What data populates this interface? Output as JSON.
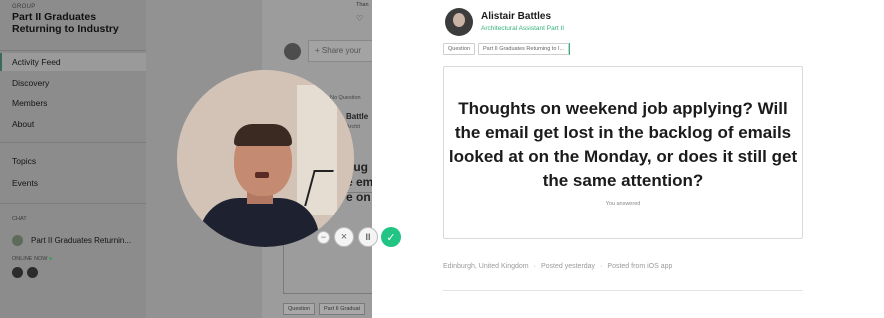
{
  "sidebar": {
    "group_label": "GROUP",
    "group_title": "Part II Graduates Returning to Industry",
    "nav": [
      {
        "label": "Activity Feed"
      },
      {
        "label": "Discovery"
      },
      {
        "label": "Members"
      },
      {
        "label": "About"
      },
      {
        "label": "Topics"
      },
      {
        "label": "Events"
      }
    ],
    "chat_label": "CHAT",
    "chat_item": "Part II Graduates Returnin...",
    "online_label": "ONLINE NOW"
  },
  "feed": {
    "top_text": "Than",
    "share_placeholder": "Share your",
    "post_tag": "No Question",
    "post_name": "Battle",
    "post_sub": "Archit",
    "post_text_lines": [
      "oug",
      "e em",
      "e on"
    ],
    "bottom_tags": [
      "Question",
      "Part II Graduat"
    ]
  },
  "controls": {
    "minus": "−",
    "close": "×",
    "pause": "II",
    "done": "✓"
  },
  "post": {
    "author_name": "Alistair Battles",
    "author_title": "Architectural Assistant Part II",
    "tags": [
      "Question",
      "Part II Graduates Returning to I..."
    ],
    "question": "Thoughts on weekend job applying? Will the email get lost in the backlog of emails looked at on the Monday, or does it still get the same attention?",
    "answered": "You answered",
    "location": "Edinburgh, United Kingdom",
    "posted": "Posted yesterday",
    "source": "Posted from iOS app"
  },
  "colors": {
    "accent": "#36b27e",
    "done_button": "#22c483"
  }
}
